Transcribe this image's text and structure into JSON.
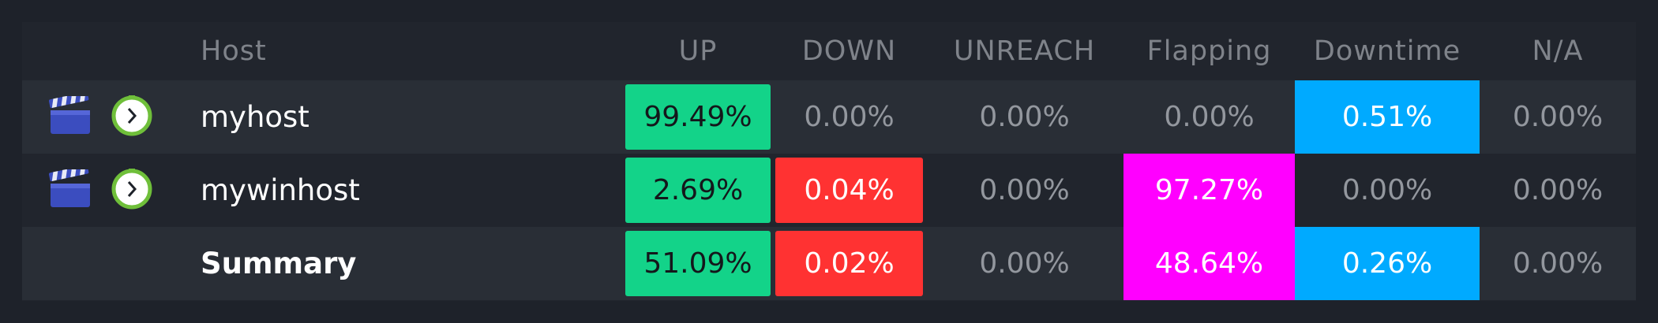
{
  "table": {
    "headers": {
      "host": "Host",
      "up": "UP",
      "down": "DOWN",
      "unreach": "UNREACH",
      "flapping": "Flapping",
      "downtime": "Downtime",
      "na": "N/A"
    },
    "rows": [
      {
        "host": "myhost",
        "up": "99.49%",
        "down": "0.00%",
        "unreach": "0.00%",
        "flapping": "0.00%",
        "downtime": "0.51%",
        "na": "0.00%",
        "icons": [
          "clapperboard-icon",
          "timeline-clock-icon"
        ]
      },
      {
        "host": "mywinhost",
        "up": "2.69%",
        "down": "0.04%",
        "unreach": "0.00%",
        "flapping": "97.27%",
        "downtime": "0.00%",
        "na": "0.00%",
        "icons": [
          "clapperboard-icon",
          "timeline-clock-icon"
        ]
      }
    ],
    "summary": {
      "host": "Summary",
      "up": "51.09%",
      "down": "0.02%",
      "unreach": "0.00%",
      "flapping": "48.64%",
      "downtime": "0.26%",
      "na": "0.00%"
    }
  },
  "colors": {
    "ok": "#13d389",
    "critical": "#ff3232",
    "flapping": "#ff00ff",
    "downtime": "#00aaff",
    "background": "#1e222a"
  }
}
